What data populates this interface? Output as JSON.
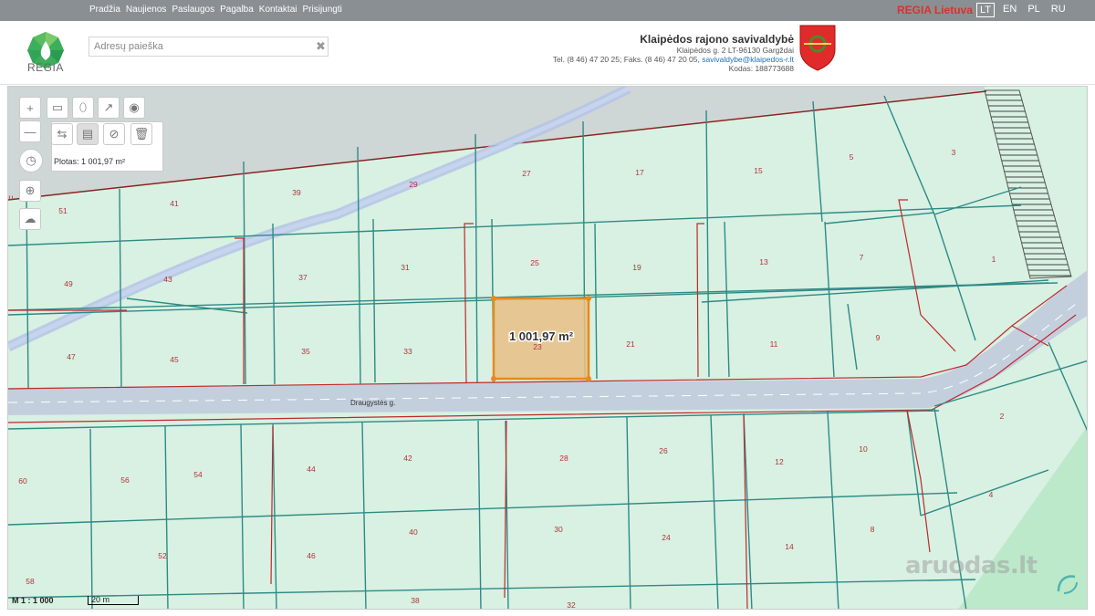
{
  "nav": [
    "Pradžia",
    "Naujienos",
    "Paslaugos",
    "Pagalba",
    "Kontaktai",
    "Prisijungti"
  ],
  "brand": "REGIA Lietuva",
  "languages": [
    {
      "code": "LT",
      "active": true
    },
    {
      "code": "EN",
      "active": false
    },
    {
      "code": "PL",
      "active": false
    },
    {
      "code": "RU",
      "active": false
    }
  ],
  "logo_text": "REGIA",
  "search": {
    "placeholder": "Adresų paieška",
    "value": ""
  },
  "municipality": {
    "name": "Klaipėdos rajono savivaldybė",
    "address": "Klaipėdos g. 2 LT-96130 Gargždai",
    "contacts_prefix": "Tel. (8 46) 47 20 25; Faks. (8 46) 47 20 05,",
    "email": "savivaldybe@klaipedos-r.lt",
    "code": "Kodas: 188773688"
  },
  "tools": {
    "row1": [
      "zoom-in-icon",
      "ruler-icon",
      "marker-icon",
      "export-icon",
      "target-icon"
    ],
    "row2": [
      "zoom-out-icon",
      "measure-line-icon",
      "measure-area-icon",
      "clear-measure-icon",
      "trash-icon"
    ],
    "side": [
      "compass-icon",
      "locate-icon",
      "region-icon"
    ]
  },
  "measurement": {
    "area_text": "Plotas: 1 001,97 m²",
    "map_label": "1 001,97 m²",
    "selected_parcel": "23"
  },
  "street_name": "Draugystės g.",
  "parcels": [
    "51",
    "41",
    "39",
    "29",
    "27",
    "17",
    "15",
    "5",
    "3",
    "49",
    "43",
    "37",
    "31",
    "25",
    "19",
    "13",
    "7",
    "1",
    "47",
    "45",
    "35",
    "33",
    "21",
    "11",
    "9",
    "60",
    "56",
    "54",
    "44",
    "42",
    "28",
    "26",
    "12",
    "10",
    "2",
    "52",
    "46",
    "40",
    "30",
    "24",
    "14",
    "8",
    "4",
    "58",
    "38",
    "32"
  ],
  "edge_label": "iu",
  "scale": {
    "ratio": "M 1 : 1 000",
    "bar": "20 m"
  },
  "watermark": "aruodas.lt",
  "colors": {
    "parcel_fill": "#d8f1e2",
    "boundary": "#2e8a86",
    "selected_fill": "#e9bf85",
    "selected_stroke": "#e58b1c",
    "utility": "#cc2a2a",
    "road": "#c4cfdd",
    "brand_red": "#d9322a"
  }
}
